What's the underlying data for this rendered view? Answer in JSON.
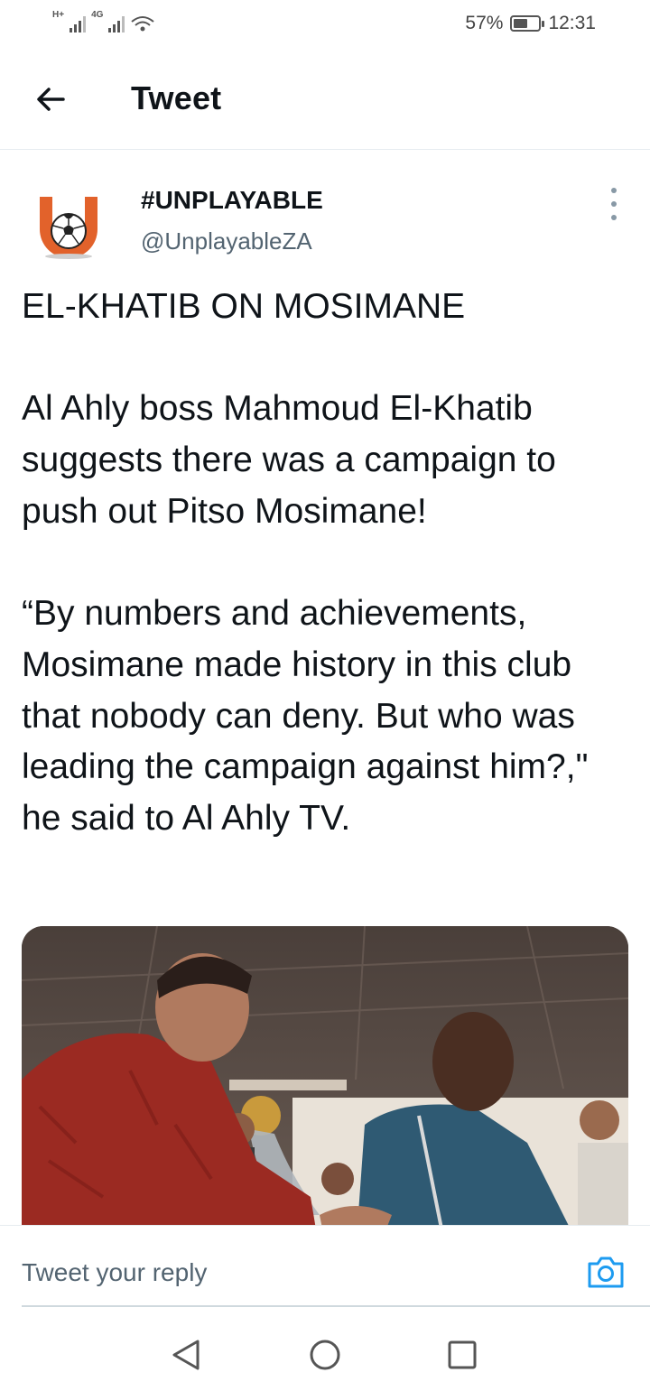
{
  "status_bar": {
    "net1": "H+",
    "net2": "4G",
    "battery_percent": "57%",
    "battery_level": 0.57,
    "time": "12:31"
  },
  "header": {
    "back_icon": "arrow-left-icon",
    "title": "Tweet"
  },
  "author": {
    "display_name": "#UNPLAYABLE",
    "handle": "@UnplayableZA",
    "avatar_icon": "unplayable-logo-icon",
    "more_icon": "more-vertical-icon",
    "brand_color": "#e2622b"
  },
  "tweet": {
    "text": "EL-KHATIB ON MOSIMANE\n\nAl Ahly boss Mahmoud El-Khatib suggests there was a campaign to push out Pitso Mosimane!\n\n“By numbers and achievements, Mosimane made history in this club that nobody can deny. But who was leading the campaign against him?,\" he said to Al Ahly TV."
  },
  "reply": {
    "placeholder": "Tweet your reply",
    "camera_icon": "camera-icon",
    "accent": "#1d9bf0"
  },
  "nav": {
    "back_icon": "triangle-back-icon",
    "home_icon": "circle-home-icon",
    "recents_icon": "square-recents-icon"
  }
}
